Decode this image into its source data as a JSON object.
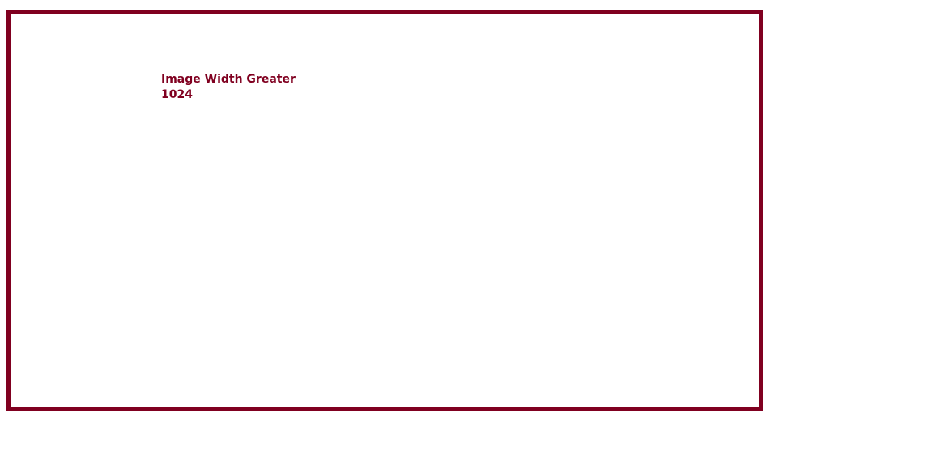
{
  "colors": {
    "frame_border": "#800020",
    "text": "#800020",
    "background": "#ffffff"
  },
  "caption": {
    "line1": "Image Width Greater",
    "line2": "1024"
  }
}
